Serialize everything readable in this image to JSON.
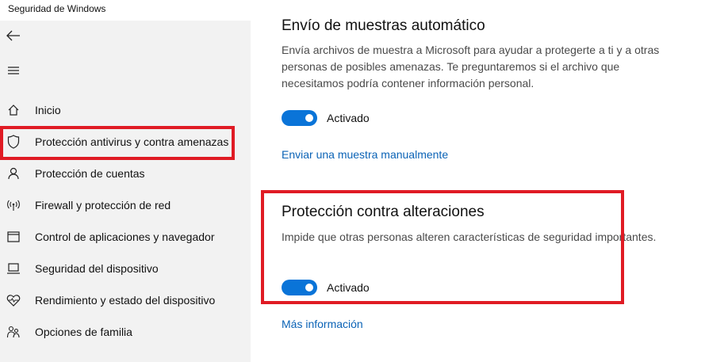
{
  "window": {
    "title": "Seguridad de Windows"
  },
  "sidebar": {
    "items": [
      {
        "label": "Inicio",
        "icon": "home-icon"
      },
      {
        "label": "Protección antivirus y contra amenazas",
        "icon": "shield-icon",
        "highlighted": true
      },
      {
        "label": "Protección de cuentas",
        "icon": "person-icon"
      },
      {
        "label": "Firewall y protección de red",
        "icon": "antenna-icon"
      },
      {
        "label": "Control de aplicaciones y navegador",
        "icon": "browser-icon"
      },
      {
        "label": "Seguridad del dispositivo",
        "icon": "laptop-icon"
      },
      {
        "label": "Rendimiento y estado del dispositivo",
        "icon": "heart-icon"
      },
      {
        "label": "Opciones de familia",
        "icon": "family-icon"
      }
    ]
  },
  "sample_submission": {
    "title": "Envío de muestras automático",
    "description": "Envía archivos de muestra a Microsoft para ayudar a protegerte a ti y a otras personas de posibles amenazas. Te preguntaremos si el archivo que necesitamos podría contener información personal.",
    "toggle_state": "on",
    "toggle_label": "Activado",
    "link": "Enviar una muestra manualmente"
  },
  "tamper_protection": {
    "title": "Protección contra alteraciones",
    "description": "Impide que otras personas alteren características de seguridad importantes.",
    "toggle_state": "on",
    "toggle_label": "Activado",
    "link": "Más información",
    "highlighted": true
  },
  "colors": {
    "accent": "#0a74d8",
    "highlight": "#e01b24",
    "link": "#0b63b6",
    "sidebar_bg": "#f2f2f2"
  }
}
